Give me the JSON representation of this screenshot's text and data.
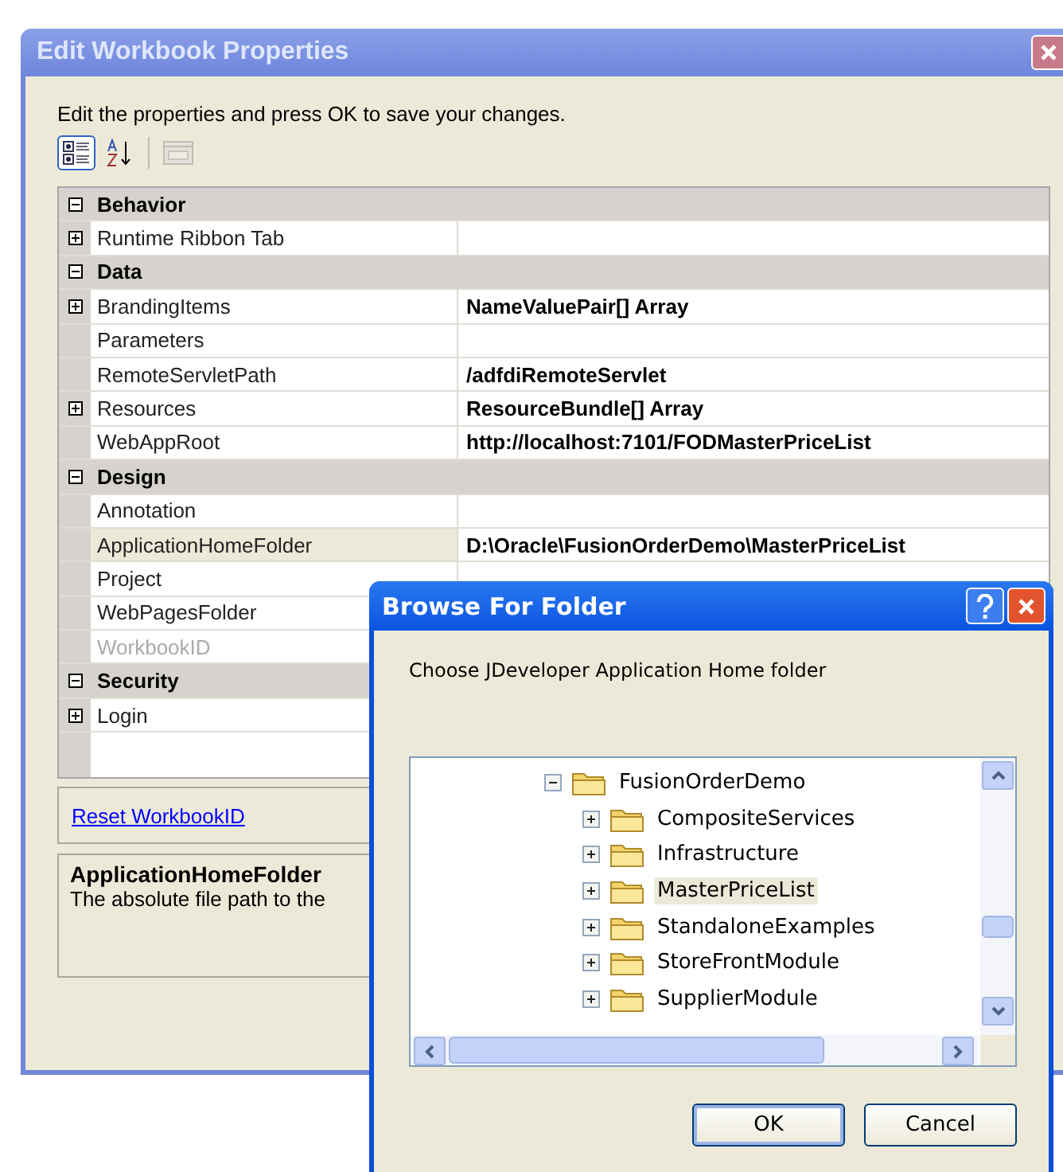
{
  "window": {
    "title": "Edit Workbook Properties",
    "instructions": "Edit the properties and press OK to save your changes."
  },
  "toolbar": [
    {
      "kind": "categorized",
      "selected": true,
      "disabled": false
    },
    {
      "kind": "alphabetical",
      "selected": false,
      "disabled": false
    },
    {
      "kind": "property-pages",
      "selected": false,
      "disabled": true
    }
  ],
  "properties": [
    {
      "category": "Behavior",
      "expanded": true,
      "items": [
        {
          "name": "Runtime Ribbon Tab",
          "kind": "collection",
          "selected": false,
          "disabled": false
        }
      ]
    },
    {
      "category": "Data",
      "expanded": true,
      "items": [
        {
          "name": "BrandingItems",
          "kind": "collection",
          "value": "NameValuePair[] Array",
          "selected": false,
          "disabled": false
        },
        {
          "name": "Parameters",
          "kind": "simple",
          "selected": false,
          "disabled": false
        },
        {
          "name": "RemoteServletPath",
          "kind": "simple",
          "value": "/adfdiRemoteServlet",
          "selected": false,
          "disabled": false
        },
        {
          "name": "Resources",
          "kind": "collection",
          "value": "ResourceBundle[] Array",
          "selected": false,
          "disabled": false
        },
        {
          "name": "WebAppRoot",
          "kind": "simple",
          "value": "http://localhost:7101/FODMasterPriceList",
          "selected": false,
          "disabled": false
        }
      ]
    },
    {
      "category": "Design",
      "expanded": true,
      "items": [
        {
          "name": "Annotation",
          "kind": "simple",
          "selected": false,
          "disabled": false
        },
        {
          "name": "ApplicationHomeFolder",
          "kind": "simple",
          "value": "D:\\Oracle\\FusionOrderDemo\\MasterPriceList",
          "selected": true,
          "disabled": false
        },
        {
          "name": "Project",
          "kind": "simple",
          "selected": false,
          "disabled": false
        },
        {
          "name": "WebPagesFolder",
          "kind": "simple",
          "selected": false,
          "disabled": false
        },
        {
          "name": "WorkbookID",
          "kind": "simple",
          "selected": false,
          "disabled": true
        }
      ]
    },
    {
      "category": "Security",
      "expanded": true,
      "items": [
        {
          "name": "Login",
          "kind": "collection",
          "selected": false,
          "disabled": false
        }
      ]
    }
  ],
  "link": "Reset WorkbookID",
  "description": {
    "title": "ApplicationHomeFolder",
    "text": "The absolute file path to the"
  },
  "browse_dialog": {
    "title": "Browse For Folder",
    "prompt": "Choose JDeveloper Application Home folder",
    "tree": [
      {
        "label": "FusionOrderDemo",
        "expanded": true,
        "selected": false,
        "children": [
          {
            "label": "CompositeServices",
            "expanded": false,
            "selected": false
          },
          {
            "label": "Infrastructure",
            "expanded": false,
            "selected": false
          },
          {
            "label": "MasterPriceList",
            "expanded": false,
            "selected": true
          },
          {
            "label": "StandaloneExamples",
            "expanded": false,
            "selected": false
          },
          {
            "label": "StoreFrontModule",
            "expanded": false,
            "selected": false
          },
          {
            "label": "SupplierModule",
            "expanded": false,
            "selected": false
          }
        ]
      }
    ],
    "buttons": [
      {
        "label": "OK",
        "default": true
      },
      {
        "label": "Cancel",
        "default": false
      }
    ]
  }
}
